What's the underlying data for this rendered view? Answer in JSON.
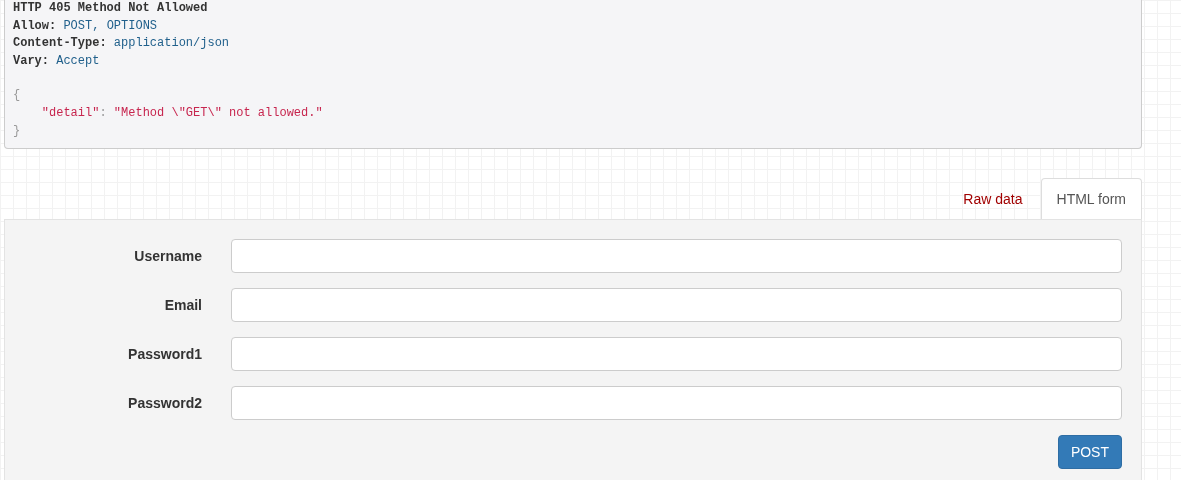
{
  "response": {
    "status_line": "HTTP 405 Method Not Allowed",
    "headers": [
      {
        "name": "Allow:",
        "value": "POST, OPTIONS"
      },
      {
        "name": "Content-Type:",
        "value": "application/json"
      },
      {
        "name": "Vary:",
        "value": "Accept"
      }
    ],
    "body": {
      "open": "{",
      "lines": [
        {
          "key": "\"detail\"",
          "separator": ":",
          "value": "\"Method \\\"GET\\\" not allowed.\""
        }
      ],
      "close": "}"
    }
  },
  "tabs": [
    {
      "label": "Raw data",
      "selected": false
    },
    {
      "label": "HTML form",
      "selected": true
    }
  ],
  "form": {
    "fields": [
      {
        "label": "Username"
      },
      {
        "label": "Email"
      },
      {
        "label": "Password1"
      },
      {
        "label": "Password2"
      }
    ],
    "submit": "POST"
  }
}
